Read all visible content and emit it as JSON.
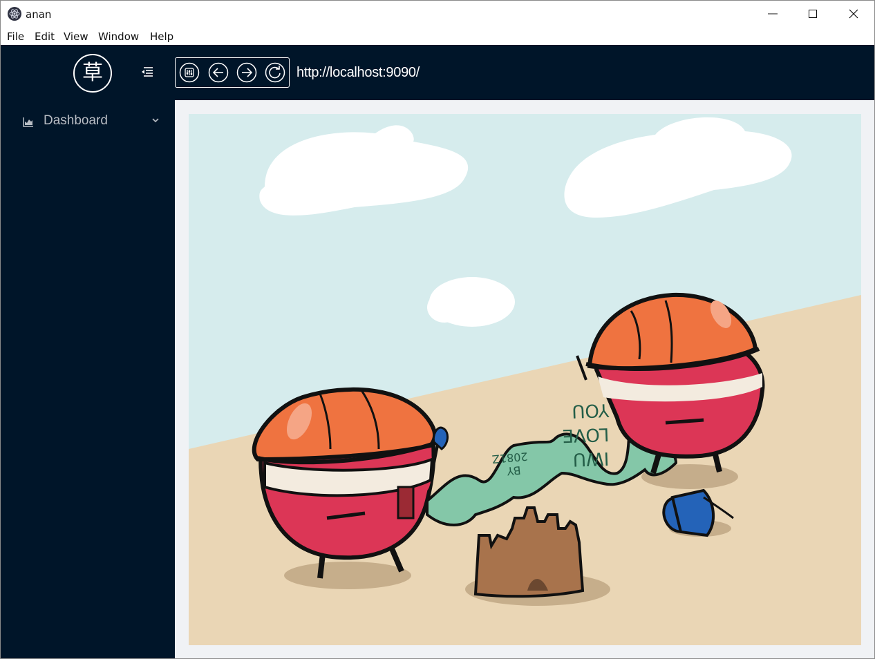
{
  "window": {
    "title": "anan"
  },
  "titlebar_icons": [
    "app-icon",
    "minimize-icon",
    "maximize-icon",
    "close-icon"
  ],
  "menubar": {
    "items": [
      "File",
      "Edit",
      "View",
      "Window",
      "Help"
    ]
  },
  "sidebar": {
    "logo": "草",
    "nav": [
      {
        "label": "Dashboard",
        "icon": "area-chart-icon"
      }
    ]
  },
  "header": {
    "tools": [
      "settings-sliders-icon",
      "back-arrow-icon",
      "forward-arrow-icon",
      "reload-icon"
    ],
    "url": "http://localhost:9090/"
  },
  "illustration": {
    "description_free": true,
    "scroll_text": [
      "YOU",
      "LOVE",
      "IWU",
      "BY",
      "2081Z"
    ]
  },
  "colors": {
    "sidebar_bg": "#001529",
    "content_bg": "#f0f2f5",
    "sky": "#d6eced",
    "sand": "#ead6b5",
    "helmet": "#ef7340",
    "body": "#dc3656",
    "scroll": "#84c7a8",
    "bucket": "#2463b8",
    "castle": "#a8734c"
  }
}
